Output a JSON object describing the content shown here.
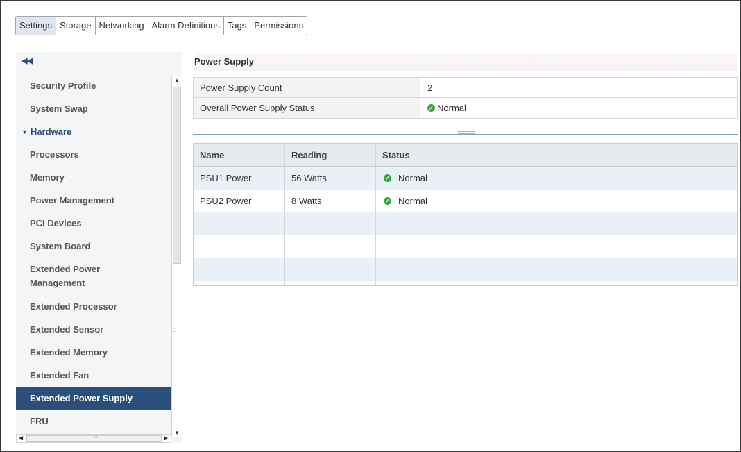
{
  "tabs": [
    "Settings",
    "Storage",
    "Networking",
    "Alarm Definitions",
    "Tags",
    "Permissions"
  ],
  "sidebar": {
    "collapse_icon": "double-chevron-left",
    "items": [
      {
        "label": "Security Profile"
      },
      {
        "label": "System Swap"
      },
      {
        "label": "Hardware"
      },
      {
        "label": "Processors"
      },
      {
        "label": "Memory"
      },
      {
        "label": "Power Management"
      },
      {
        "label": "PCI Devices"
      },
      {
        "label": "System Board"
      },
      {
        "label": "Extended Power Management"
      },
      {
        "label": "Extended Processor"
      },
      {
        "label": "Extended Sensor"
      },
      {
        "label": "Extended Memory"
      },
      {
        "label": "Extended Fan"
      },
      {
        "label": "Extended Power Supply"
      },
      {
        "label": "FRU"
      }
    ],
    "selected": "Extended Power Supply"
  },
  "main": {
    "title": "Power Supply",
    "properties": [
      {
        "label": "Power Supply Count",
        "value": "2"
      },
      {
        "label": "Overall Power Supply Status",
        "value": "Normal"
      }
    ],
    "table": {
      "columns": [
        "Name",
        "Reading",
        "Status"
      ],
      "rows": [
        {
          "name": "PSU1 Power",
          "reading": "56 Watts",
          "status": "Normal"
        },
        {
          "name": "PSU2 Power",
          "reading": "8 Watts",
          "status": "Normal"
        }
      ]
    }
  },
  "colors": {
    "accent": "#2a4f7a",
    "status_ok": "#3aa63a",
    "row_alt": "#eaf0f8"
  }
}
